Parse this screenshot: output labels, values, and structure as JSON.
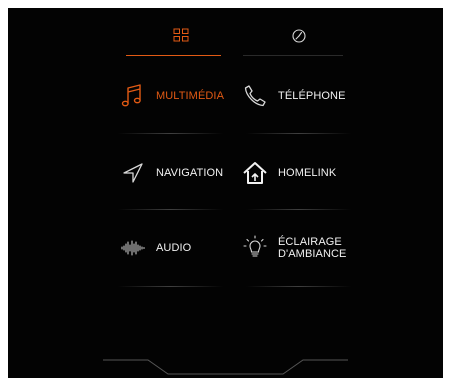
{
  "tabs": [
    {
      "id": "apps",
      "icon": "apps-grid-icon",
      "active": true
    },
    {
      "id": "clock",
      "icon": "clock-icon",
      "active": false
    }
  ],
  "tiles": [
    {
      "id": "multimedia",
      "label": "MULTIMÉDIA",
      "icon": "music-note-icon",
      "active": true
    },
    {
      "id": "telephone",
      "label": "TÉLÉPHONE",
      "icon": "phone-icon",
      "active": false
    },
    {
      "id": "navigation",
      "label": "NAVIGATION",
      "icon": "navigation-arrow-icon",
      "active": false
    },
    {
      "id": "homelink",
      "label": "HOMELINK",
      "icon": "home-icon",
      "active": false
    },
    {
      "id": "audio",
      "label": "AUDIO",
      "icon": "audio-wave-icon",
      "active": false
    },
    {
      "id": "ambient",
      "label_line1": "ÉCLAIRAGE",
      "label_line2": "D'AMBIANCE",
      "icon": "lightbulb-icon",
      "active": false
    }
  ],
  "colors": {
    "accent": "#e25a14",
    "text": "#f2f2f2",
    "icon": "#d8d8d8",
    "background": "#030303"
  }
}
